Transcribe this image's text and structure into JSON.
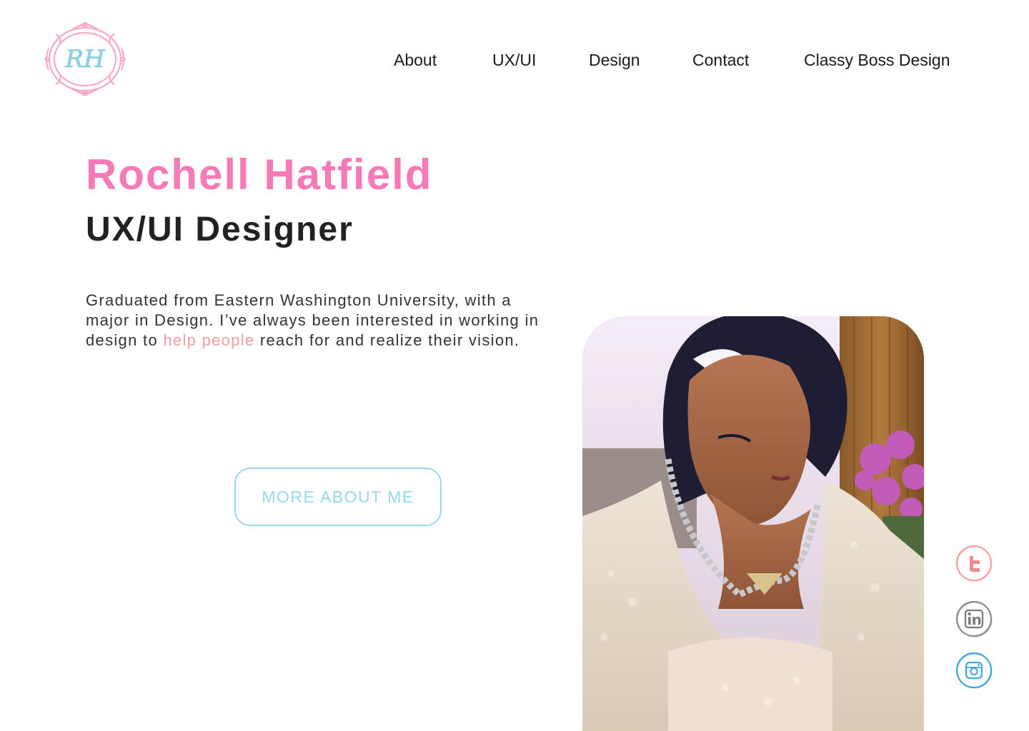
{
  "logo": {
    "monogram": "RH",
    "frame_color": "#f6a9c8",
    "letter_color": "#8fd3e6"
  },
  "nav": {
    "items": [
      {
        "label": "About"
      },
      {
        "label": "UX/UI"
      },
      {
        "label": "Design"
      },
      {
        "label": "Contact"
      },
      {
        "label": "Classy Boss Design"
      }
    ]
  },
  "hero": {
    "name": "Rochell Hatfield",
    "role": "UX/UI Designer",
    "bio_before": "Graduated from Eastern Washington University, with a major in Design. I’ve always been interested in working in design to ",
    "bio_highlight": "help people",
    "bio_after": " reach for and realize their vision.",
    "button_label": "MORE ABOUT ME"
  },
  "photo": {
    "subject": "portrait-photo"
  },
  "social": [
    {
      "icon": "twitter-icon",
      "color": "#f7a1a5"
    },
    {
      "icon": "linkedin-icon",
      "color": "#8c8c8c"
    },
    {
      "icon": "instagram-icon",
      "color": "#3fa9d9"
    }
  ],
  "colors": {
    "name": "#f57ab6",
    "highlight": "#f39ea3",
    "button": "#98d9e6"
  }
}
